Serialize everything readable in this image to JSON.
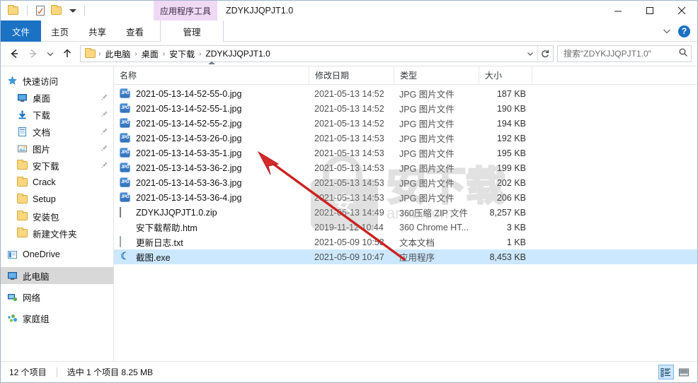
{
  "titlebar": {
    "quick_access": [
      {
        "name": "folder-icon",
        "label": ""
      },
      {
        "name": "properties-icon",
        "label": ""
      },
      {
        "name": "new-folder-icon",
        "label": ""
      },
      {
        "name": "customize-qat-caret-icon",
        "label": ""
      }
    ],
    "contextual_tools": "应用程序工具",
    "window_title": "ZDYKJJQPJT1.0",
    "minimize": "—",
    "maximize": "□",
    "close": "✕"
  },
  "ribbon": {
    "tabs": [
      {
        "label": "文件",
        "active": true
      },
      {
        "label": "主页",
        "active": false
      },
      {
        "label": "共享",
        "active": false
      },
      {
        "label": "查看",
        "active": false
      },
      {
        "label": "管理",
        "active": false
      }
    ],
    "collapse_icon": "chevron-down-icon",
    "help_label": "?"
  },
  "addressbar": {
    "back": "←",
    "forward": "→",
    "recent": "⌄",
    "up": "↑",
    "breadcrumbs": [
      "此电脑",
      "桌面",
      "安下载",
      "ZDYKJJQPJT1.0"
    ],
    "breadcrumb_separator": "›",
    "dropdown_caret": "⌄",
    "refresh": "↻",
    "search": {
      "placeholder": "搜索\"ZDYKJJQPJT1.0\"",
      "value": "",
      "icon": "search-icon"
    }
  },
  "sidebar": {
    "items": [
      {
        "label": "快速访问",
        "icon": "star-pin-icon",
        "level": 0,
        "pinned": false,
        "selected": false
      },
      {
        "label": "桌面",
        "icon": "desktop-icon",
        "level": 1,
        "pinned": true,
        "selected": false
      },
      {
        "label": "下载",
        "icon": "downloads-icon",
        "level": 1,
        "pinned": true,
        "selected": false
      },
      {
        "label": "文档",
        "icon": "documents-icon",
        "level": 1,
        "pinned": true,
        "selected": false
      },
      {
        "label": "图片",
        "icon": "pictures-icon",
        "level": 1,
        "pinned": true,
        "selected": false
      },
      {
        "label": "安下载",
        "icon": "folder-icon",
        "level": 1,
        "pinned": true,
        "selected": false
      },
      {
        "label": "Crack",
        "icon": "folder-icon",
        "level": 1,
        "pinned": false,
        "selected": false
      },
      {
        "label": "Setup",
        "icon": "folder-icon",
        "level": 1,
        "pinned": false,
        "selected": false
      },
      {
        "label": "安装包",
        "icon": "folder-icon",
        "level": 1,
        "pinned": false,
        "selected": false
      },
      {
        "label": "新建文件夹",
        "icon": "folder-icon",
        "level": 1,
        "pinned": false,
        "selected": false
      },
      {
        "label": "OneDrive",
        "icon": "onedrive-icon",
        "level": 0,
        "pinned": false,
        "selected": false
      },
      {
        "label": "此电脑",
        "icon": "this-pc-icon",
        "level": 0,
        "pinned": false,
        "selected": true
      },
      {
        "label": "网络",
        "icon": "network-icon",
        "level": 0,
        "pinned": false,
        "selected": false
      },
      {
        "label": "家庭组",
        "icon": "homegroup-icon",
        "level": 0,
        "pinned": false,
        "selected": false
      }
    ]
  },
  "filelist": {
    "columns": [
      {
        "label": "名称",
        "sorted": "asc"
      },
      {
        "label": "修改日期",
        "sorted": ""
      },
      {
        "label": "类型",
        "sorted": ""
      },
      {
        "label": "大小",
        "sorted": ""
      }
    ],
    "rows": [
      {
        "name": "2021-05-13-14-52-55-0.jpg",
        "date": "2021-05-13 14:52",
        "type": "JPG 图片文件",
        "size": "187 KB",
        "icon": "jpg-file-icon",
        "selected": false
      },
      {
        "name": "2021-05-13-14-52-55-1.jpg",
        "date": "2021-05-13 14:52",
        "type": "JPG 图片文件",
        "size": "190 KB",
        "icon": "jpg-file-icon",
        "selected": false
      },
      {
        "name": "2021-05-13-14-52-55-2.jpg",
        "date": "2021-05-13 14:52",
        "type": "JPG 图片文件",
        "size": "194 KB",
        "icon": "jpg-file-icon",
        "selected": false
      },
      {
        "name": "2021-05-13-14-53-26-0.jpg",
        "date": "2021-05-13 14:53",
        "type": "JPG 图片文件",
        "size": "192 KB",
        "icon": "jpg-file-icon",
        "selected": false
      },
      {
        "name": "2021-05-13-14-53-35-1.jpg",
        "date": "2021-05-13 14:53",
        "type": "JPG 图片文件",
        "size": "195 KB",
        "icon": "jpg-file-icon",
        "selected": false
      },
      {
        "name": "2021-05-13-14-53-36-2.jpg",
        "date": "2021-05-13 14:53",
        "type": "JPG 图片文件",
        "size": "199 KB",
        "icon": "jpg-file-icon",
        "selected": false
      },
      {
        "name": "2021-05-13-14-53-36-3.jpg",
        "date": "2021-05-13 14:53",
        "type": "JPG 图片文件",
        "size": "202 KB",
        "icon": "jpg-file-icon",
        "selected": false
      },
      {
        "name": "2021-05-13-14-53-36-4.jpg",
        "date": "2021-05-13 14:53",
        "type": "JPG 图片文件",
        "size": "206 KB",
        "icon": "jpg-file-icon",
        "selected": false
      },
      {
        "name": "ZDYKJJQPJT1.0.zip",
        "date": "2021-05-13 14:49",
        "type": "360压缩 ZIP 文件",
        "size": "8,257 KB",
        "icon": "zip-file-icon",
        "selected": false
      },
      {
        "name": "安下载帮助.htm",
        "date": "2019-11-12 10:44",
        "type": "360 Chrome HT...",
        "size": "3 KB",
        "icon": "htm-file-icon",
        "selected": false
      },
      {
        "name": "更新日志.txt",
        "date": "2021-05-09 10:53",
        "type": "文本文档",
        "size": "1 KB",
        "icon": "txt-file-icon",
        "selected": false
      },
      {
        "name": "截图.exe",
        "date": "2021-05-09 10:47",
        "type": "应用程序",
        "size": "8,453 KB",
        "icon": "exe-file-icon",
        "selected": true
      }
    ]
  },
  "statusbar": {
    "item_count": "12 个项目",
    "selection": "选中 1 个项目  8.25 MB",
    "details_view_icon": "details-view-icon",
    "large_icons_view_icon": "large-icons-view-icon"
  },
  "watermark": {
    "brand_text": "安",
    "site_text": "anxz.com",
    "logo_text": "安下载"
  },
  "colors": {
    "accent": "#1b72c4",
    "selection": "#cce8ff",
    "contextual_tab": "#f0d9f5",
    "arrow": "#cc2222",
    "sidebar_selected": "#d8d8d8"
  }
}
